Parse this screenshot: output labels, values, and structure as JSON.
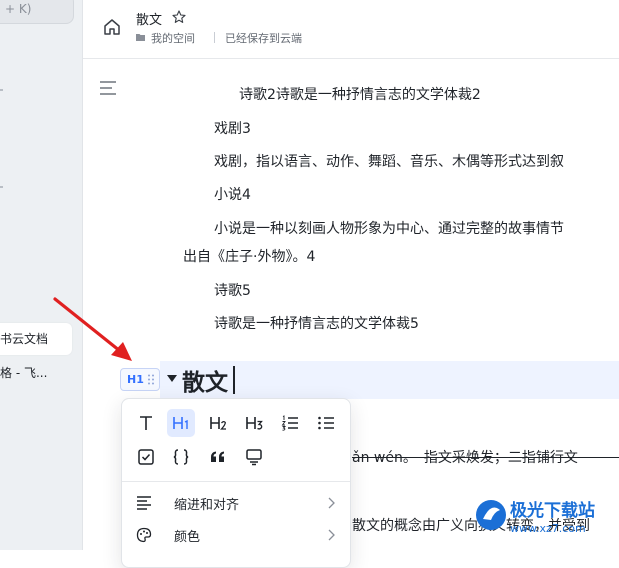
{
  "sidebar": {
    "search_hint": "+ K)",
    "items": [
      {
        "label": "书云文档",
        "active": true
      },
      {
        "label": "格 - 飞..."
      }
    ]
  },
  "header": {
    "title": "散文",
    "breadcrumb": "我的空间",
    "save_status": "已经保存到云端"
  },
  "document": {
    "lines": [
      "诗歌2诗歌是一种抒情言志的文学体裁2",
      "戏剧3",
      "戏剧，指以语言、动作、舞蹈、音乐、木偶等形式达到叙",
      "小说4",
      "小说是一种以刻画人物形象为中心、通过完整的故事情节",
      "出自《庄子·外物》。4",
      "诗歌5",
      "诗歌是一种抒情言志的文学体裁5"
    ],
    "heading_level": "H1",
    "heading_text": "散文",
    "partial_line_1": "ǎn wén。　指文采焕发；二指铺行文",
    "partial_line_2": "散文的概念由广义向狭义转变，并受到"
  },
  "block_menu": {
    "format_buttons": [
      {
        "name": "text",
        "label": "T"
      },
      {
        "name": "heading-1",
        "label": "H1",
        "active": true
      },
      {
        "name": "heading-2",
        "label": "H2"
      },
      {
        "name": "heading-3",
        "label": "H3"
      },
      {
        "name": "ordered-list",
        "label": ""
      },
      {
        "name": "bullet-list",
        "label": ""
      },
      {
        "name": "checkbox",
        "label": ""
      },
      {
        "name": "code-block",
        "label": "{}"
      },
      {
        "name": "quote",
        "label": "66"
      },
      {
        "name": "callout",
        "label": ""
      }
    ],
    "rows": [
      {
        "label": "缩进和对齐"
      },
      {
        "label": "颜色"
      }
    ]
  },
  "watermark": {
    "title": "极光下载站",
    "url": "www.xz7.com"
  },
  "colors": {
    "accent": "#3370ff",
    "arrow": "#e02020",
    "sidebar_bg": "#edf0f3",
    "highlight_bg": "#eef3ff"
  }
}
